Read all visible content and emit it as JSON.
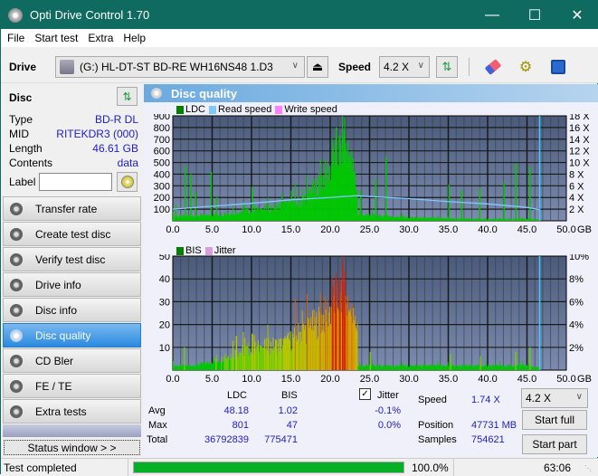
{
  "app": {
    "title": "Opti Drive Control 1.70"
  },
  "window_controls": {
    "minimize": "—",
    "maximize": "☐",
    "close": "✕"
  },
  "menu": [
    "File",
    "Start test",
    "Extra",
    "Help"
  ],
  "toolbar": {
    "drive_label": "Drive",
    "drive_value": "(G:)   HL-DT-ST BD-RE  WH16NS48 1.D3",
    "speed_label": "Speed",
    "speed_value": "4.2 X"
  },
  "disc": {
    "title": "Disc",
    "rows": [
      {
        "k": "Type",
        "v": "BD-R DL"
      },
      {
        "k": "MID",
        "v": "RITEKDR3 (000)"
      },
      {
        "k": "Length",
        "v": "46.61 GB"
      },
      {
        "k": "Contents",
        "v": "data"
      }
    ],
    "label_key": "Label",
    "label_value": ""
  },
  "nav": [
    {
      "label": "Transfer rate",
      "active": false
    },
    {
      "label": "Create test disc",
      "active": false
    },
    {
      "label": "Verify test disc",
      "active": false
    },
    {
      "label": "Drive info",
      "active": false
    },
    {
      "label": "Disc info",
      "active": false
    },
    {
      "label": "Disc quality",
      "active": true
    },
    {
      "label": "CD Bler",
      "active": false
    },
    {
      "label": "FE / TE",
      "active": false
    },
    {
      "label": "Extra tests",
      "active": false
    }
  ],
  "status_window_label": "Status window > >",
  "panel_title": "Disc quality",
  "legend_top": [
    {
      "label": "LDC",
      "color": "#008000"
    },
    {
      "label": "Read speed",
      "color": "#80c8ff"
    },
    {
      "label": "Write speed",
      "color": "#ff80ff"
    }
  ],
  "legend_bottom": [
    {
      "label": "BIS",
      "color": "#008000"
    },
    {
      "label": "Jitter",
      "color": "#d8a0d8"
    }
  ],
  "chart_data": [
    {
      "type": "bar",
      "title": "LDC",
      "x_unit": "GB",
      "xlim": [
        0,
        50
      ],
      "x_ticks": [
        "0.0",
        "5.0",
        "10.0",
        "15.0",
        "20.0",
        "25.0",
        "30.0",
        "35.0",
        "40.0",
        "45.0",
        "50.0"
      ],
      "ylim_left": [
        0,
        900
      ],
      "y_ticks_left": [
        "100",
        "200",
        "300",
        "400",
        "500",
        "600",
        "700",
        "800",
        "900"
      ],
      "ylim_right": [
        0,
        18
      ],
      "y_ticks_right": [
        "2 X",
        "4 X",
        "6 X",
        "8 X",
        "10 X",
        "12 X",
        "14 X",
        "16 X",
        "18 X"
      ],
      "grid": true,
      "end_marker_gb": 46.61,
      "ldc_envelope": {
        "x": [
          0,
          2,
          4,
          6,
          8,
          10,
          12,
          14,
          16,
          17,
          18,
          19,
          20,
          20.5,
          21,
          21.5,
          22,
          22.5,
          23,
          23.4,
          23.5,
          25,
          30,
          35,
          40,
          45,
          46.6
        ],
        "y": [
          40,
          45,
          50,
          60,
          80,
          95,
          110,
          140,
          170,
          220,
          290,
          380,
          480,
          560,
          620,
          650,
          640,
          560,
          420,
          250,
          60,
          50,
          30,
          20,
          15,
          15,
          10
        ]
      },
      "ldc_spikes": [
        {
          "x": 0.3,
          "y": 140
        },
        {
          "x": 1.5,
          "y": 470
        },
        {
          "x": 2.2,
          "y": 400
        },
        {
          "x": 2.8,
          "y": 250
        },
        {
          "x": 4.8,
          "y": 420
        },
        {
          "x": 5.5,
          "y": 200
        },
        {
          "x": 10.0,
          "y": 290
        },
        {
          "x": 13.8,
          "y": 230
        },
        {
          "x": 15.0,
          "y": 260
        },
        {
          "x": 20.7,
          "y": 801
        },
        {
          "x": 21.5,
          "y": 730
        },
        {
          "x": 23.8,
          "y": 260
        },
        {
          "x": 25.7,
          "y": 360
        },
        {
          "x": 27.0,
          "y": 550
        },
        {
          "x": 35.0,
          "y": 310
        },
        {
          "x": 36.6,
          "y": 260
        },
        {
          "x": 38.9,
          "y": 280
        },
        {
          "x": 42.0,
          "y": 330
        },
        {
          "x": 43.5,
          "y": 490
        },
        {
          "x": 45.3,
          "y": 460
        }
      ],
      "read_speed": {
        "x": [
          0,
          5,
          10,
          15,
          20,
          23.3,
          23.4,
          30,
          35,
          40,
          45,
          46.6
        ],
        "y": [
          2.0,
          2.5,
          3.0,
          3.6,
          4.0,
          4.3,
          4.3,
          3.8,
          3.3,
          2.9,
          2.3,
          1.9
        ]
      }
    },
    {
      "type": "bar",
      "title": "BIS",
      "x_unit": "GB",
      "xlim": [
        0,
        50
      ],
      "x_ticks": [
        "0.0",
        "5.0",
        "10.0",
        "15.0",
        "20.0",
        "25.0",
        "30.0",
        "35.0",
        "40.0",
        "45.0",
        "50.0"
      ],
      "ylim_left": [
        0,
        50
      ],
      "y_ticks_left": [
        "10",
        "20",
        "30",
        "40",
        "50"
      ],
      "ylim_right": [
        0,
        10
      ],
      "y_ticks_right": [
        "2%",
        "4%",
        "6%",
        "8%",
        "10%"
      ],
      "grid": true,
      "end_marker_gb": 46.61,
      "bis_envelope": {
        "x": [
          0,
          2,
          4,
          6,
          8,
          10,
          12,
          14,
          15,
          16,
          17,
          18,
          19,
          20,
          20.5,
          21,
          21.5,
          22,
          22.5,
          23,
          23.4,
          23.5,
          25,
          30,
          35,
          40,
          45,
          46.6
        ],
        "y": [
          2,
          2,
          3,
          5,
          8,
          10,
          11,
          12,
          14,
          17,
          19,
          21,
          24,
          28,
          32,
          35,
          33,
          31,
          26,
          22,
          20,
          2,
          2,
          2,
          2,
          2,
          2,
          1
        ]
      },
      "bis_spikes": [
        {
          "x": 1.4,
          "y": 10
        },
        {
          "x": 8.0,
          "y": 15
        },
        {
          "x": 10.0,
          "y": 16
        },
        {
          "x": 21.5,
          "y": 47
        },
        {
          "x": 25.0,
          "y": 8
        },
        {
          "x": 35.2,
          "y": 7
        },
        {
          "x": 39.0,
          "y": 6
        },
        {
          "x": 43.5,
          "y": 8
        },
        {
          "x": 45.3,
          "y": 10
        }
      ]
    }
  ],
  "stats": {
    "col_ldc": "LDC",
    "col_bis": "BIS",
    "jitter_label": "Jitter",
    "jitter_checked": true,
    "rows": [
      {
        "k": "Avg",
        "ldc": "48.18",
        "bis": "1.02",
        "jitter": "-0.1%"
      },
      {
        "k": "Max",
        "ldc": "801",
        "bis": "47",
        "jitter": "0.0%"
      },
      {
        "k": "Total",
        "ldc": "36792839",
        "bis": "775471",
        "jitter": ""
      }
    ],
    "speed_label": "Speed",
    "speed_value": "1.74 X",
    "position_label": "Position",
    "position_value": "47731 MB",
    "samples_label": "Samples",
    "samples_value": "754621",
    "speed_select": "4.2 X",
    "start_full": "Start full",
    "start_part": "Start part"
  },
  "statusbar": {
    "text": "Test completed",
    "progress": 1.0,
    "progress_text": "100.0%",
    "time": "63:06"
  }
}
